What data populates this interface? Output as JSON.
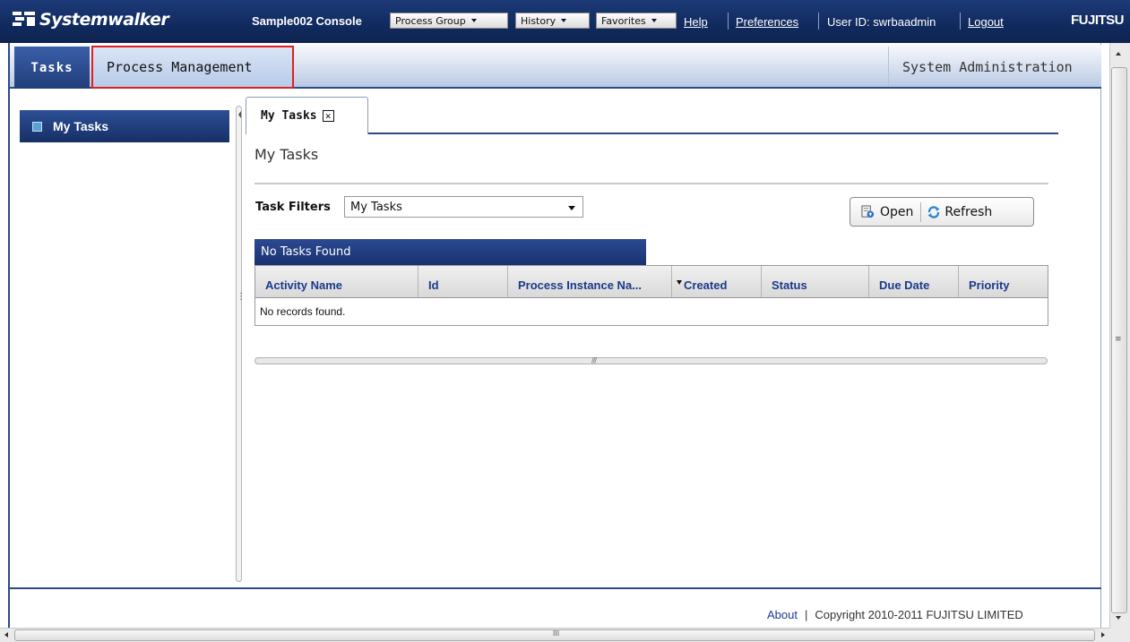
{
  "header": {
    "logo_text": "Systemwalker",
    "console_title": "Sample002 Console",
    "menus": [
      {
        "label": "Process Group"
      },
      {
        "label": "History"
      },
      {
        "label": "Favorites"
      }
    ],
    "help_label": "Help",
    "preferences_label": "Preferences",
    "user_id_text": "User ID: swrbaadmin",
    "logout_label": "Logout",
    "brand_text": "FUJITSU"
  },
  "tabs": {
    "tasks_label": "Tasks",
    "process_management_label": "Process Management",
    "system_administration_label": "System Administration"
  },
  "sidebar": {
    "items": [
      {
        "label": "My Tasks"
      }
    ]
  },
  "main": {
    "tab_label": "My Tasks",
    "tab_close_glyph": "✕",
    "page_title": "My Tasks",
    "filter": {
      "label": "Task Filters",
      "selected": "My Tasks"
    },
    "actions": {
      "open_label": "Open",
      "refresh_label": "Refresh"
    },
    "grid": {
      "status_bar_text": "No Tasks Found",
      "columns": [
        {
          "label": "Activity Name"
        },
        {
          "label": "Id"
        },
        {
          "label": "Process Instance Na..."
        },
        {
          "label": "Created",
          "sorted": true
        },
        {
          "label": "Status"
        },
        {
          "label": "Due Date"
        },
        {
          "label": "Priority"
        }
      ],
      "empty_text": "No records found."
    }
  },
  "footer": {
    "about_label": "About",
    "separator": "|",
    "copyright": "Copyright 2010-2011 FUJITSU LIMITED"
  },
  "colors": {
    "header_bg": "#112a5e",
    "accent_blue": "#2a4a88",
    "highlight_border": "#e0201e",
    "link_blue": "#1a3a9a"
  },
  "icons": {
    "open": "open-doc-icon",
    "refresh": "refresh-icon",
    "nav": "square-icon"
  }
}
